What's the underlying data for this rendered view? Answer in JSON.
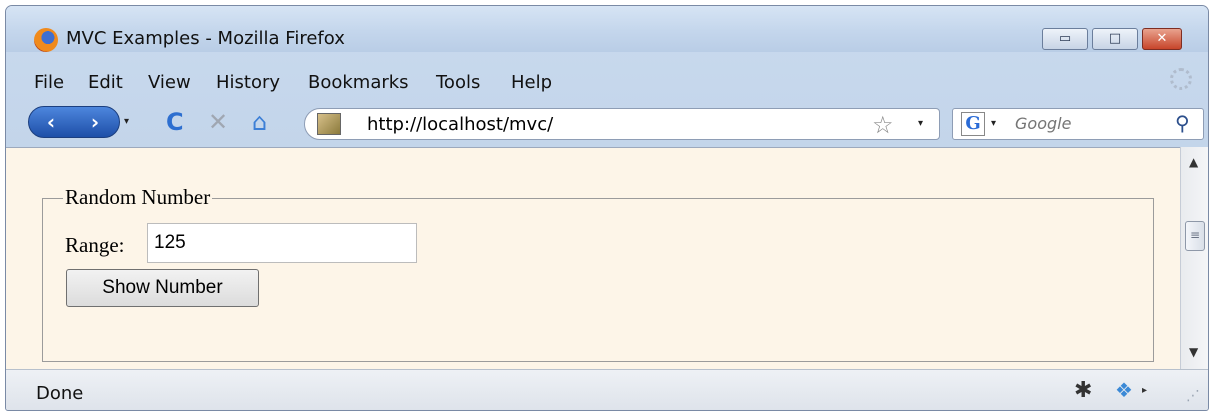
{
  "window": {
    "title": "MVC Examples - Mozilla Firefox",
    "controls": {
      "minimize": "▭",
      "maximize": "□",
      "close": "✕"
    }
  },
  "menu": [
    "File",
    "Edit",
    "View",
    "History",
    "Bookmarks",
    "Tools",
    "Help"
  ],
  "toolbar": {
    "back": "‹",
    "forward": "›",
    "dropdown": "▾",
    "reload": "C",
    "stop": "✕",
    "home": "⌂",
    "url": "http://localhost/mvc/",
    "bookmark_star": "☆",
    "search_engine": "G",
    "search_placeholder": "Google",
    "search_button": "⚲"
  },
  "page": {
    "legend": "Random Number",
    "range_label": "Range:",
    "range_value": "125",
    "button_label": "Show Number"
  },
  "scrollbar": {
    "up": "▲",
    "down": "▼",
    "grip": "≡"
  },
  "status": {
    "text": "Done",
    "bug": "✱",
    "addon": "❖",
    "arrow": "▸",
    "resize": "⋰"
  },
  "colors": {
    "page_bg": "#fdf5e8",
    "chrome": "#c9daee",
    "accent": "#2a6bd6"
  }
}
